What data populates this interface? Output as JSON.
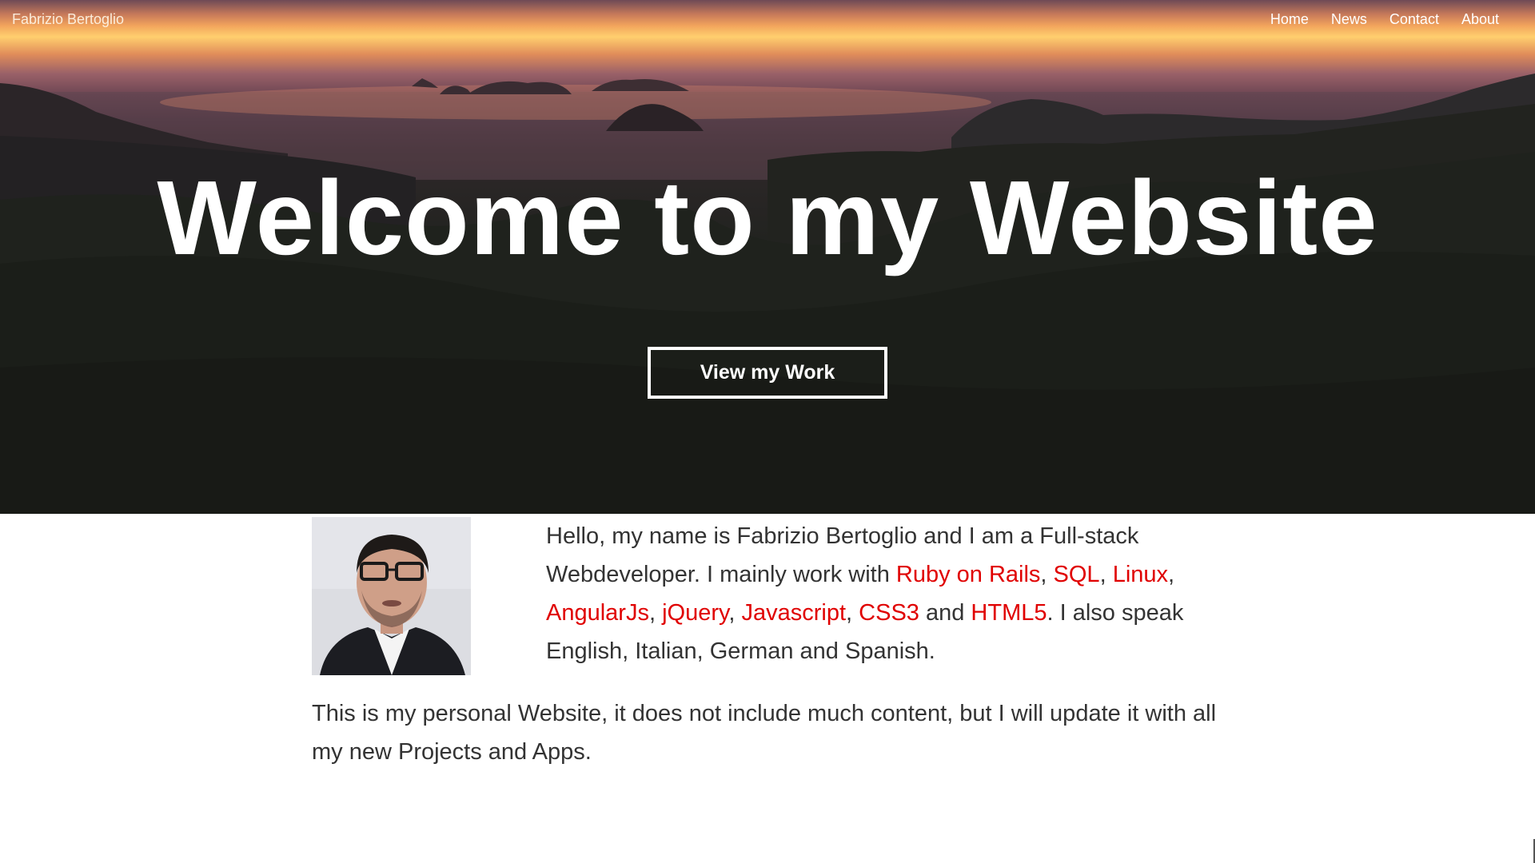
{
  "header": {
    "brand": "Fabrizio Bertoglio",
    "nav": [
      {
        "label": "Home"
      },
      {
        "label": "News"
      },
      {
        "label": "Contact"
      },
      {
        "label": "About"
      }
    ]
  },
  "hero": {
    "title": "Welcome to my Website",
    "button_label": "View my Work"
  },
  "about": {
    "bio_intro": "Hello, my name is Fabrizio Bertoglio and I am a Full-stack Webdeveloper. I mainly work with ",
    "skills": [
      "Ruby on Rails",
      "SQL",
      "Linux",
      "AngularJs",
      "jQuery",
      "Javascript",
      "CSS3",
      "HTML5"
    ],
    "sep_comma": ", ",
    "sep_and": " and ",
    "bio_outro": ". I also speak English, Italian, German and Spanish.",
    "personal_note": "This is my personal Website, it does not include much content, but I will update it with all my new Projects and Apps."
  },
  "colors": {
    "link": "#e00000",
    "text": "#333333",
    "hero_text": "#ffffff"
  }
}
